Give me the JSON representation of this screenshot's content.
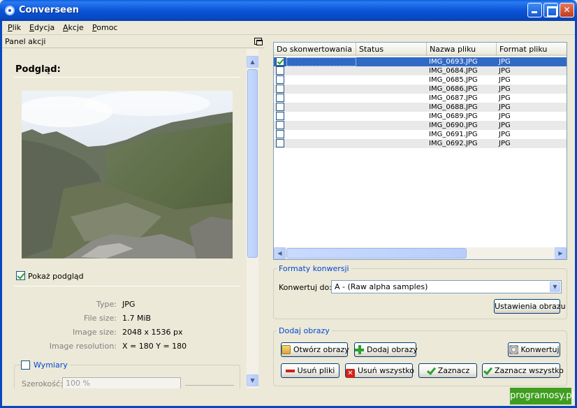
{
  "window": {
    "title": "Converseen"
  },
  "menu": {
    "items": [
      "Plik",
      "Edycja",
      "Akcje",
      "Pomoc"
    ]
  },
  "left_panel": {
    "header": "Panel akcji",
    "preview_title": "Podgląd:",
    "show_preview_label": "Pokaż podgląd",
    "show_preview_checked": true,
    "info": [
      {
        "label": "Type:",
        "value": "JPG"
      },
      {
        "label": "File size:",
        "value": "1.7 MiB"
      },
      {
        "label": "Image size:",
        "value": "2048 x 1536 px"
      },
      {
        "label": "Image resolution:",
        "value": "X = 180 Y = 180"
      }
    ],
    "dimensions_group": "Wymiary",
    "width_label": "Szerokość:",
    "width_value": "100 %"
  },
  "file_list": {
    "columns": [
      "Do skonwertowania",
      "Status",
      "Nazwa pliku",
      "Format pliku"
    ],
    "rows": [
      {
        "checked": true,
        "status": "",
        "name": "IMG_0693.JPG",
        "format": "JPG",
        "selected": true
      },
      {
        "checked": false,
        "status": "",
        "name": "IMG_0684.JPG",
        "format": "JPG",
        "selected": false
      },
      {
        "checked": false,
        "status": "",
        "name": "IMG_0685.JPG",
        "format": "JPG",
        "selected": false
      },
      {
        "checked": false,
        "status": "",
        "name": "IMG_0686.JPG",
        "format": "JPG",
        "selected": false
      },
      {
        "checked": false,
        "status": "",
        "name": "IMG_0687.JPG",
        "format": "JPG",
        "selected": false
      },
      {
        "checked": false,
        "status": "",
        "name": "IMG_0688.JPG",
        "format": "JPG",
        "selected": false
      },
      {
        "checked": false,
        "status": "",
        "name": "IMG_0689.JPG",
        "format": "JPG",
        "selected": false
      },
      {
        "checked": false,
        "status": "",
        "name": "IMG_0690.JPG",
        "format": "JPG",
        "selected": false
      },
      {
        "checked": false,
        "status": "",
        "name": "IMG_0691.JPG",
        "format": "JPG",
        "selected": false
      },
      {
        "checked": false,
        "status": "",
        "name": "IMG_0692.JPG",
        "format": "JPG",
        "selected": false
      }
    ]
  },
  "conversion": {
    "group_title": "Formaty konwersji",
    "convert_to_label": "Konwertuj do:",
    "convert_to_value": "A - (Raw alpha samples)",
    "image_settings_button": "Ustawienia obrazu"
  },
  "add_images": {
    "group_title": "Dodaj obrazy",
    "open_button": "Otwórz obrazy",
    "add_button": "Dodaj obrazy",
    "convert_button": "Konwertuj",
    "remove_button": "Usuń pliki",
    "remove_all_button": "Usuń wszystko",
    "select_button": "Zaznacz",
    "select_all_button": "Zaznacz wszystko"
  },
  "watermark": "programosy.pl",
  "colors": {
    "titlebar": "#0a55d8",
    "selection": "#316ac5",
    "group_title": "#0046d5",
    "watermark": "#3f9e1f"
  }
}
